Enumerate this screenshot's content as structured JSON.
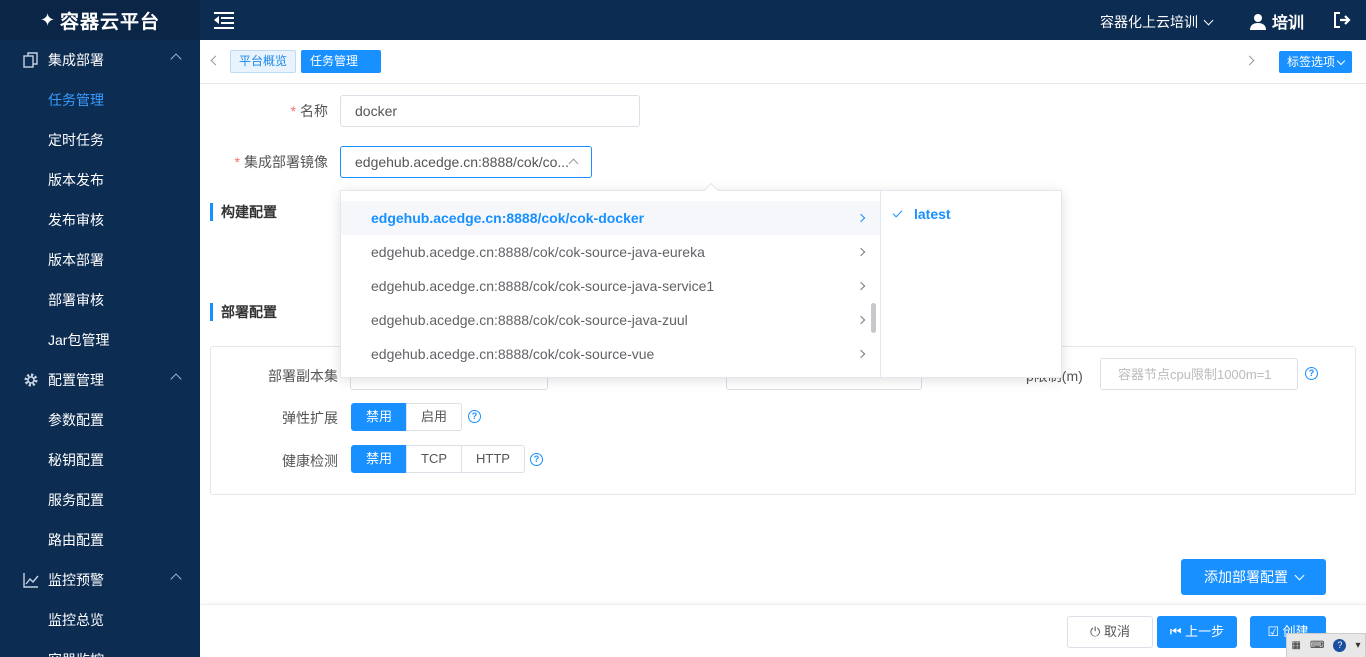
{
  "app": {
    "logo_text": "容器云平台"
  },
  "sidebar": {
    "groups": [
      {
        "label": "集成部署",
        "items": [
          "任务管理",
          "定时任务",
          "版本发布",
          "发布审核",
          "版本部署",
          "部署审核",
          "Jar包管理"
        ]
      },
      {
        "label": "配置管理",
        "items": [
          "参数配置",
          "秘钥配置",
          "服务配置",
          "路由配置"
        ]
      },
      {
        "label": "监控预警",
        "items": [
          "监控总览",
          "容器监控"
        ]
      }
    ]
  },
  "header": {
    "project": "容器化上云培训",
    "user": "培训"
  },
  "tabs": {
    "home": "平台概览",
    "current": "任务管理",
    "options": "标签选项"
  },
  "form": {
    "name_label": "名称",
    "name_value": "docker",
    "image_label": "集成部署镜像",
    "image_value": "edgehub.acedge.cn:8888/cok/co...",
    "build_section": "构建配置",
    "deploy_section": "部署配置",
    "replicas_label": "部署副本集",
    "cpu_label_suffix": "p限制(m)",
    "cpu_placeholder": "容器节点cpu限制1000m=1",
    "elastic_label": "弹性扩展",
    "elastic_options": [
      "禁用",
      "启用"
    ],
    "health_label": "健康检测",
    "health_options": [
      "禁用",
      "TCP",
      "HTTP"
    ],
    "add_deploy_button": "添加部署配置"
  },
  "cascader": {
    "images": [
      "edgehub.acedge.cn:8888/cok/cok-docker",
      "edgehub.acedge.cn:8888/cok/cok-source-java-eureka",
      "edgehub.acedge.cn:8888/cok/cok-source-java-service1",
      "edgehub.acedge.cn:8888/cok/cok-source-java-zuul",
      "edgehub.acedge.cn:8888/cok/cok-source-vue"
    ],
    "selected_tag": "latest"
  },
  "footer": {
    "cancel": "取消",
    "prev": "上一步",
    "create": "创建"
  },
  "colors": {
    "primary": "#1890ff",
    "sidebar_bg": "#0c2c52",
    "required": "#f56c6c"
  }
}
